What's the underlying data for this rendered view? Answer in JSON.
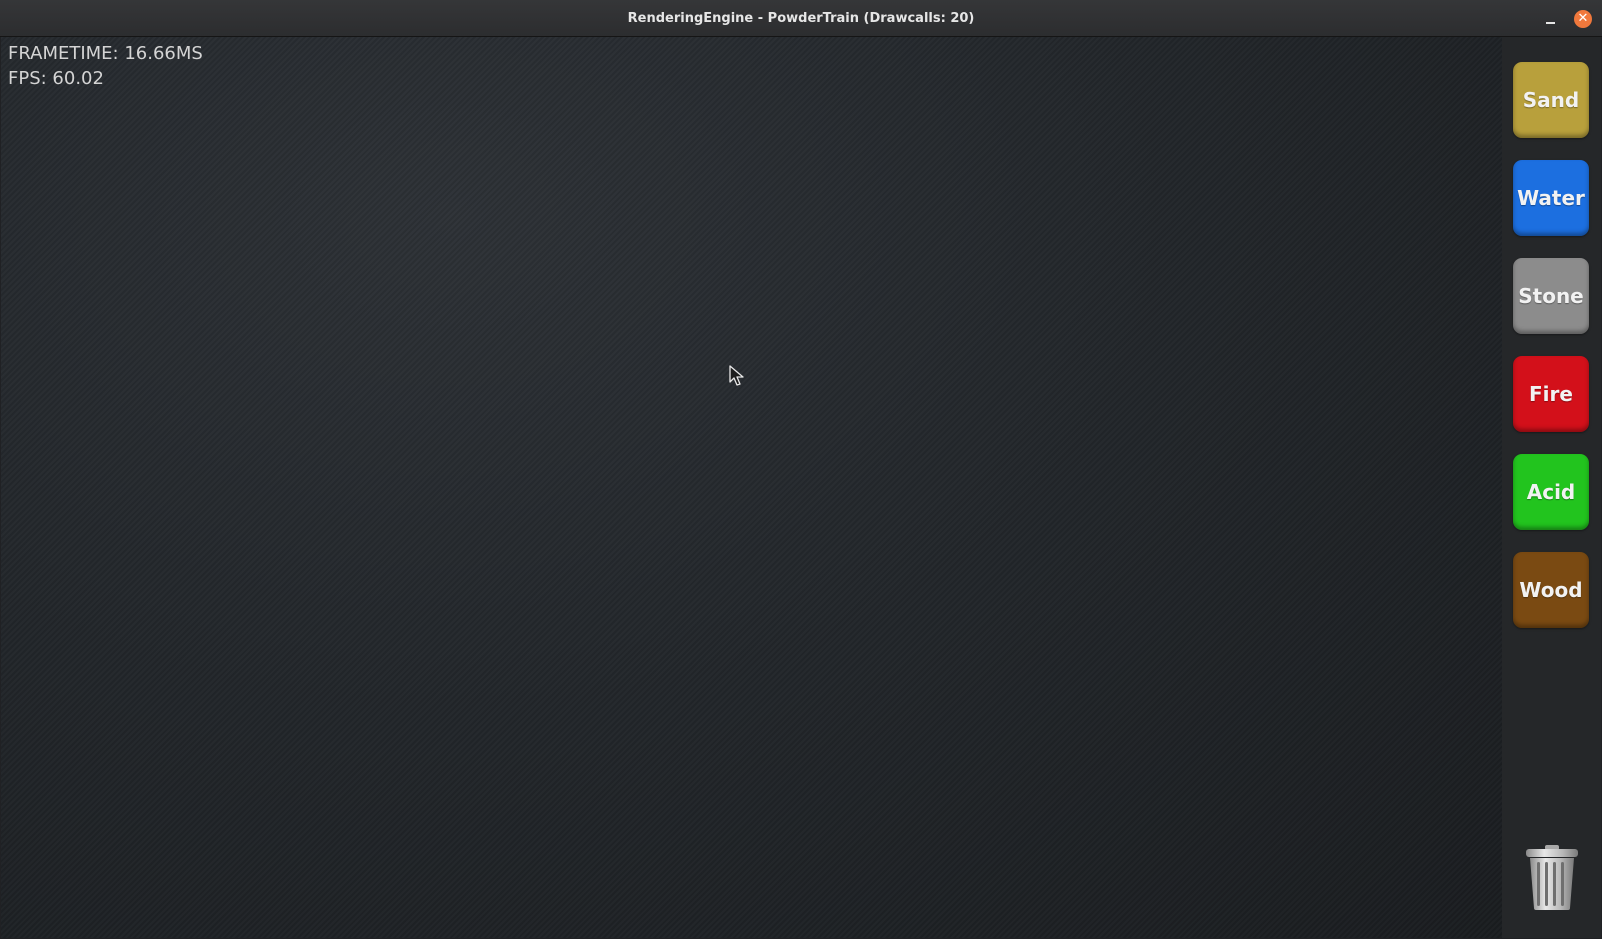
{
  "window": {
    "title": "RenderingEngine - PowderTrain (Drawcalls: 20)",
    "minimize_icon": "minimize-icon",
    "close_icon": "close-icon",
    "close_glyph": "✕"
  },
  "stats": {
    "frametime": "FRAMETIME: 16.66MS",
    "fps": "FPS: 60.02"
  },
  "materials": [
    {
      "label": "Sand",
      "color": "#b8a03c"
    },
    {
      "label": "Water",
      "color": "#1c6fe0"
    },
    {
      "label": "Stone",
      "color": "#8c8c8c"
    },
    {
      "label": "Fire",
      "color": "#d3101a"
    },
    {
      "label": "Acid",
      "color": "#22c41e"
    },
    {
      "label": "Wood",
      "color": "#7a4a12"
    }
  ],
  "tools": {
    "trash_icon": "trash-icon"
  },
  "cursor_icon": "pointer-cursor-icon"
}
